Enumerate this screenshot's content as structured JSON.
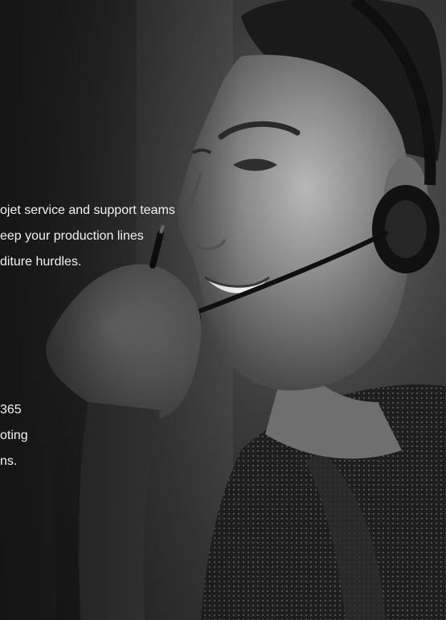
{
  "hero": {
    "paragraph_top": [
      "ojet service and support teams",
      "eep your production lines",
      "diture hurdles."
    ],
    "paragraph_bottom": [
      "365",
      "oting",
      "ns."
    ]
  },
  "colors": {
    "text": "#f2f2f2",
    "background": "#1c1c1c"
  }
}
